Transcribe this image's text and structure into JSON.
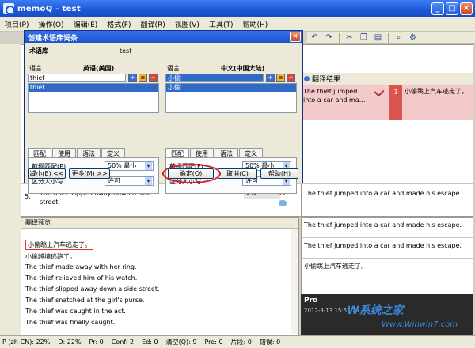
{
  "window": {
    "title": "memoQ - test"
  },
  "menu": [
    "项目(P)",
    "操作(O)",
    "编辑(E)",
    "格式(F)",
    "翻译(R)",
    "视图(V)",
    "工具(T)",
    "帮助(H)"
  ],
  "translation_results": {
    "header": "翻译结果",
    "row": {
      "source": "The thief jumped into a car and ma...",
      "flag": "1",
      "target": "小偷跳上汽车逃走了。"
    }
  },
  "grid_row5": {
    "number": "5.",
    "source": "The thief slipped away down a side street.",
    "match": "0%",
    "target": "The thief jumped into a car and made his escape."
  },
  "preview": {
    "header": "翻译预览",
    "lines": [
      "小偷跳上汽车逃走了。",
      "小偷越墙逃跑了。",
      "The thief made away with her ring.",
      "The thief relieved him of his watch.",
      "The thief slipped away down a side street.",
      "The thief snatched at the girl's purse.",
      "The thief was caught in the act.",
      "The thief was finally caught."
    ]
  },
  "right_pane": {
    "blocks": [
      "The thief jumped into a car and made his escape.",
      "The thief jumped into a car and made his escape.",
      "小偷跳上汽车逃走了。"
    ],
    "pro_label": "Pro",
    "pro_date": "2012-3-13 15:52:25"
  },
  "watermark": {
    "brand": "W系统之家",
    "url": "Www.Winwin7.com"
  },
  "dialog": {
    "title": "创建术语库词条",
    "termbase_label": "术语库",
    "termbase_value": "test",
    "left": {
      "lang_label": "语言",
      "lang_name": "英语(美国)",
      "term": "thief",
      "list_item": "thief",
      "tabs": [
        "匹配",
        "使用",
        "语法",
        "定义"
      ],
      "prefix_label": "前缀匹配(P)",
      "prefix_value": "50% 最小",
      "case_label": "区分大小写",
      "case_value": "许可"
    },
    "right": {
      "lang_label": "语言",
      "lang_name": "中文(中国大陆)",
      "term": "小偷",
      "list_item": "小偷",
      "tabs": [
        "匹配",
        "使用",
        "语法",
        "定义"
      ],
      "prefix_label": "前缀匹配(F)",
      "prefix_value": "50% 最小",
      "case_label": "区分大小写",
      "case_value": "许可"
    },
    "buttons": {
      "less": "减小(E) <<",
      "more": "更多(M) >>",
      "ok": "确定(O)",
      "cancel": "取消(C)",
      "help": "帮助(H)"
    }
  },
  "status": [
    "P (zh-CN): 22%",
    "D: 22%",
    "Pr: 0",
    "Conf: 2",
    "Ed: 0",
    "清空(Q): 9",
    "Pre: 0",
    "片段: 0",
    "错误: 0"
  ]
}
